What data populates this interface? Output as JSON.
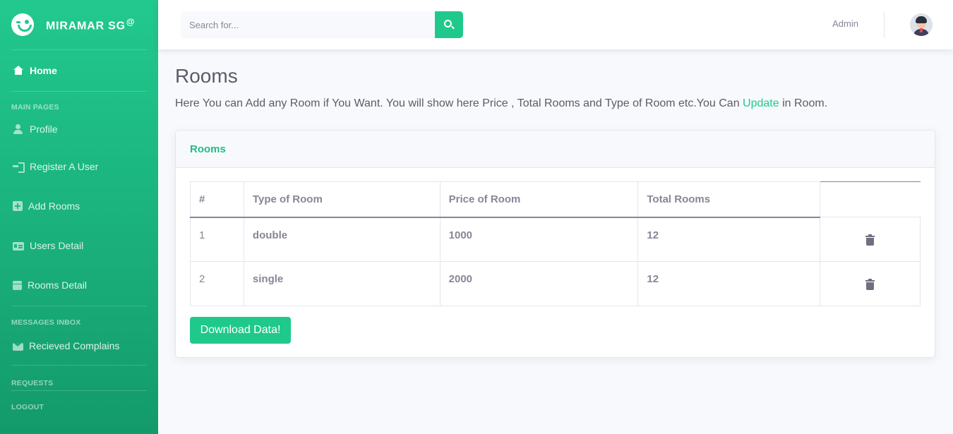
{
  "brand": {
    "name": "MIRAMAR SG",
    "superscript": "@"
  },
  "sidebar": {
    "home": "Home",
    "sections": {
      "main_pages": "MAIN PAGES",
      "messages_inbox": "MESSAGES INBOX",
      "requests": "REQUESTS",
      "logout": "LOGOUT"
    },
    "items": [
      {
        "label": "Profile",
        "icon": "user-icon"
      },
      {
        "label": "Register A User",
        "icon": "sign-in-icon"
      },
      {
        "label": "Add Rooms",
        "icon": "plus-square-icon"
      },
      {
        "label": "Users Detail",
        "icon": "id-card-icon"
      },
      {
        "label": "Rooms Detail",
        "icon": "calendar-icon"
      }
    ],
    "messages": [
      {
        "label": "Recieved Complains",
        "icon": "envelope-icon"
      }
    ]
  },
  "topbar": {
    "search_placeholder": "Search for...",
    "user_name": "Admin"
  },
  "page": {
    "title": "Rooms",
    "desc_before": "Here You can Add any Room if You Want. You will show here Price , Total Rooms and Type of Room etc.You Can ",
    "desc_link": "Update",
    "desc_after": " in Room."
  },
  "card": {
    "title": "Rooms",
    "columns": [
      "#",
      "Type of Room",
      "Price of Room",
      "Total Rooms"
    ],
    "rows": [
      {
        "num": "1",
        "type": "double",
        "price": "1000",
        "total": "12"
      },
      {
        "num": "2",
        "type": "single",
        "price": "2000",
        "total": "12"
      }
    ],
    "download_label": "Download Data!"
  },
  "colors": {
    "accent": "#1fc98b",
    "text": "#5a5c69",
    "muted": "#858796"
  }
}
